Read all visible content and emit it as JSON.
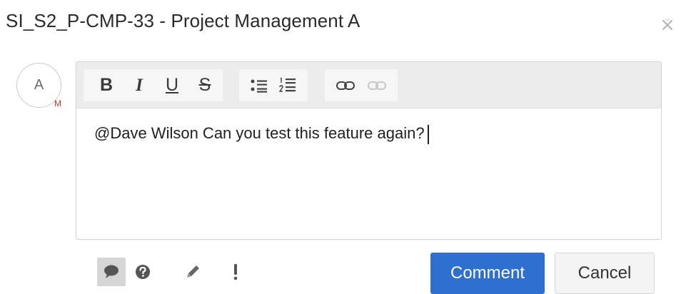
{
  "dialog": {
    "title": "SI_S2_P-CMP-33 - Project Management A",
    "close_icon": "close-icon"
  },
  "avatar": {
    "letter": "A",
    "sub_letter": "M"
  },
  "toolbar": {
    "bold": "B",
    "italic": "I",
    "underline": "U",
    "strikethrough": "S",
    "icons": [
      "bulleted-list-icon",
      "numbered-list-icon",
      "link-icon",
      "unlink-icon"
    ]
  },
  "editor": {
    "text": "@Dave Wilson Can you test this feature again?"
  },
  "footer": {
    "icons": [
      "comment-icon",
      "question-icon",
      "pencil-icon",
      "exclamation-icon"
    ],
    "comment_label": "Comment",
    "cancel_label": "Cancel"
  },
  "colors": {
    "primary": "#2f6fd0",
    "avatar_sub": "#c0392b"
  }
}
